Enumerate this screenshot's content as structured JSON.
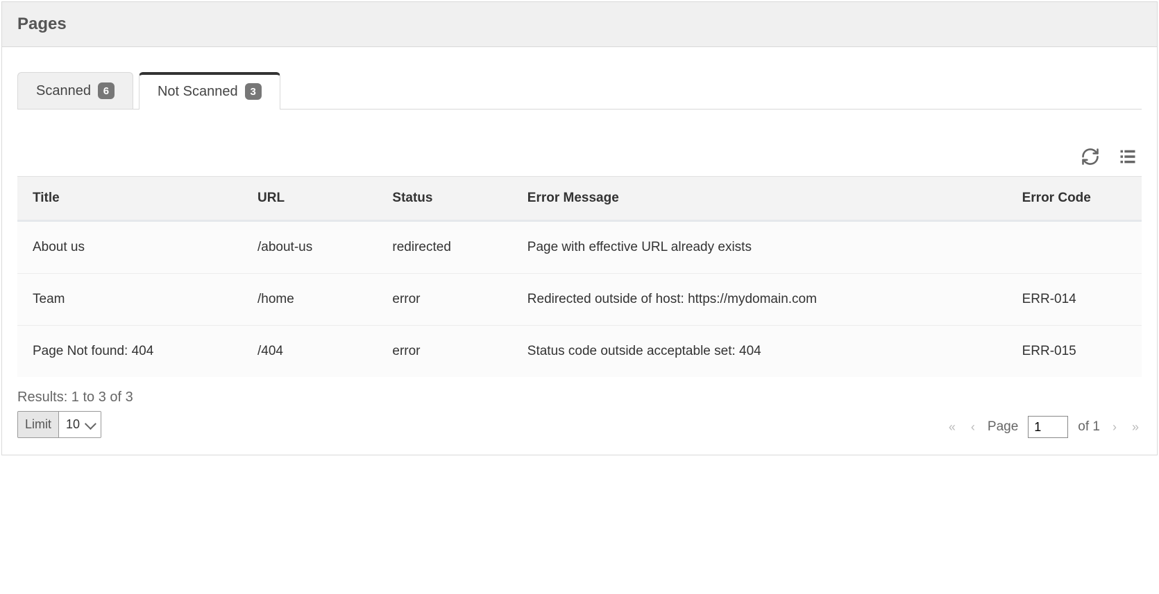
{
  "panel": {
    "title": "Pages"
  },
  "tabs": [
    {
      "label": "Scanned",
      "count": "6",
      "active": false
    },
    {
      "label": "Not Scanned",
      "count": "3",
      "active": true
    }
  ],
  "columns": [
    "Title",
    "URL",
    "Status",
    "Error Message",
    "Error Code"
  ],
  "rows": [
    {
      "title": "About us",
      "url": "/about-us",
      "status": "redirected",
      "message": "Page with effective URL already exists",
      "code": ""
    },
    {
      "title": "Team",
      "url": "/home",
      "status": "error",
      "message": "Redirected outside of host: https://mydomain.com",
      "code": "ERR-014"
    },
    {
      "title": "Page Not found: 404",
      "url": "/404",
      "status": "error",
      "message": "Status code outside acceptable set: 404",
      "code": "ERR-015"
    }
  ],
  "results_text": "Results: 1 to 3 of 3",
  "limit": {
    "label": "Limit",
    "value": "10"
  },
  "pagination": {
    "page_label": "Page",
    "current": "1",
    "of_text": "of 1"
  }
}
